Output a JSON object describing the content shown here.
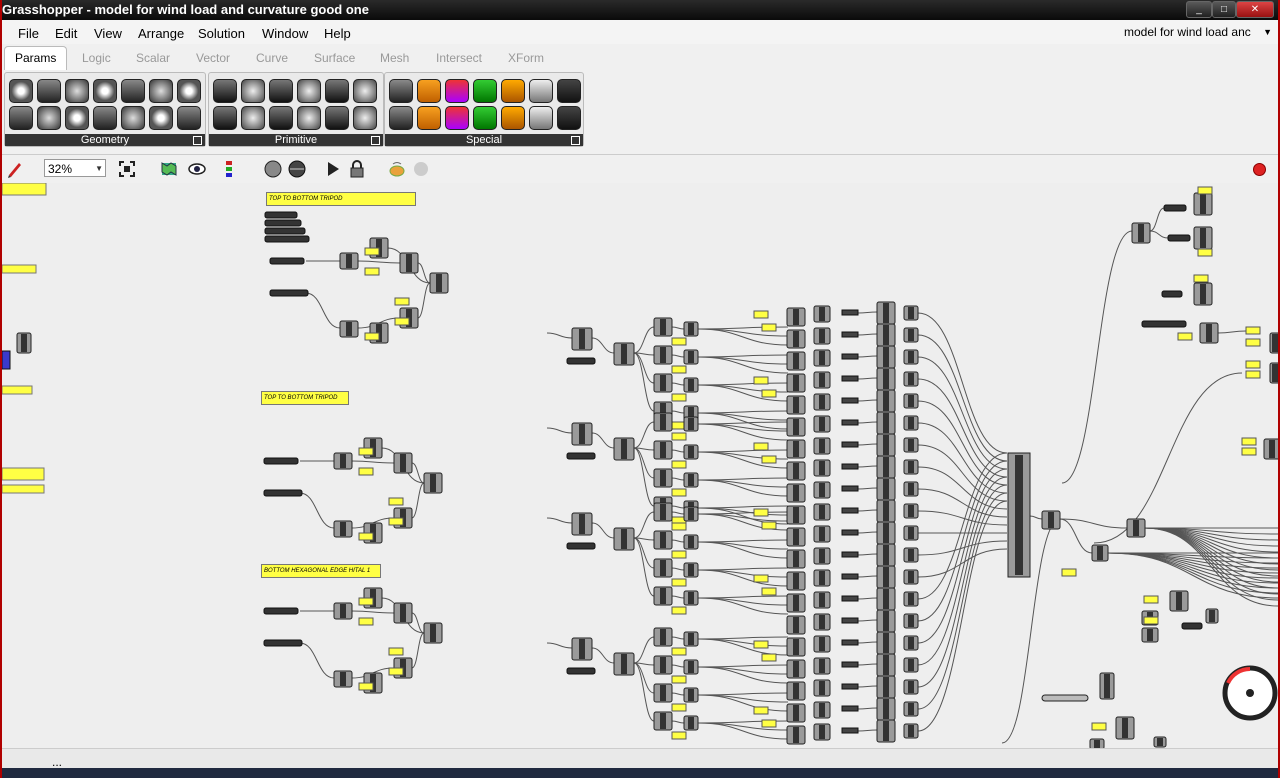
{
  "window": {
    "title": "Grasshopper - model for wind load and curvature good one",
    "document_selector": "model for wind load anc"
  },
  "menu": [
    "File",
    "Edit",
    "View",
    "Arrange",
    "Solution",
    "Window",
    "Help"
  ],
  "tabs": [
    "Params",
    "Logic",
    "Scalar",
    "Vector",
    "Curve",
    "Surface",
    "Mesh",
    "Intersect",
    "XForm"
  ],
  "ribbon": {
    "groups": [
      {
        "label": "Geometry"
      },
      {
        "label": "Primitive"
      },
      {
        "label": "Special"
      }
    ]
  },
  "toolbar": {
    "zoom": "32%"
  },
  "canvas": {
    "group_labels": [
      "TOP TO BOTTOM TRIPOD",
      "TOP TO BOTTOM TRIPOD",
      "BOTTOM HEXAGONAL EDGE HITAL 1"
    ]
  },
  "status": {
    "text": "..."
  },
  "colors": {
    "panel_yellow": "#ffff44",
    "component_gray": "#8a8a8a",
    "title_red": "#b00000"
  }
}
